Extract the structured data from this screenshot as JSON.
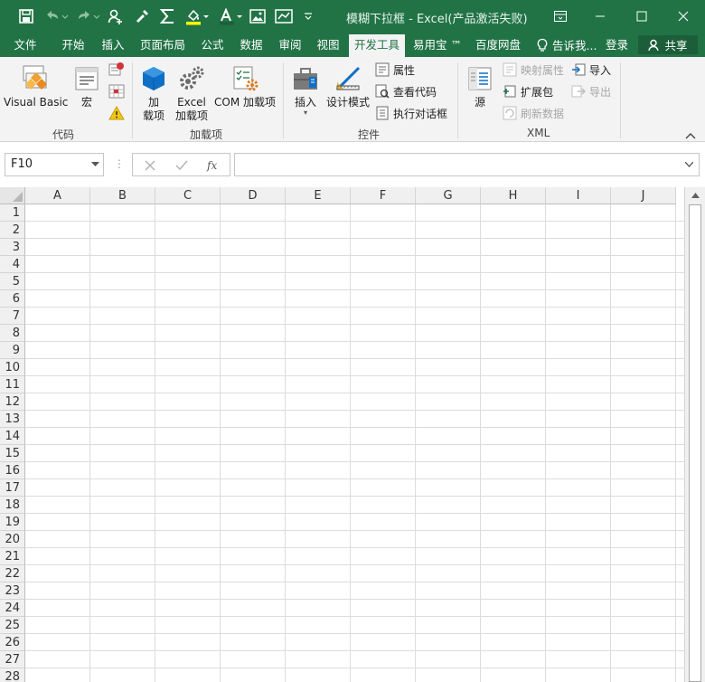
{
  "window": {
    "title": "模糊下拉框 - Excel(产品激活失败)"
  },
  "tabs": [
    {
      "label": "文件"
    },
    {
      "label": "开始"
    },
    {
      "label": "插入"
    },
    {
      "label": "页面布局"
    },
    {
      "label": "公式"
    },
    {
      "label": "数据"
    },
    {
      "label": "审阅"
    },
    {
      "label": "视图"
    },
    {
      "label": "开发工具",
      "active": true
    },
    {
      "label": "易用宝 ™"
    },
    {
      "label": "百度网盘"
    }
  ],
  "tell_me": "告诉我...",
  "login": "登录",
  "share": "共享",
  "ribbon": {
    "groups": {
      "code": "代码",
      "addins": "加载项",
      "controls": "控件",
      "xml": "XML"
    },
    "visual_basic": "Visual Basic",
    "macro": "宏",
    "addins_btn": "加\n载项",
    "addins_line1": "加",
    "addins_line2": "载项",
    "excel_addins_line1": "Excel",
    "excel_addins_line2": "加载项",
    "com_addins": "COM 加载项",
    "insert": "插入",
    "design_mode": "设计模式",
    "properties": "属性",
    "view_code": "查看代码",
    "run_dialog": "执行对话框",
    "source": "源",
    "map_properties": "映射属性",
    "expansion_packs": "扩展包",
    "refresh_data": "刷新数据",
    "import": "导入",
    "export": "导出"
  },
  "formula_bar": {
    "name_box": "F10",
    "formula": ""
  },
  "grid": {
    "columns": [
      "A",
      "B",
      "C",
      "D",
      "E",
      "F",
      "G",
      "H",
      "I",
      "J"
    ],
    "rows": [
      "1",
      "2",
      "3",
      "4",
      "5",
      "6",
      "7",
      "8",
      "9",
      "10",
      "11",
      "12",
      "13",
      "14",
      "15",
      "16",
      "17",
      "18",
      "19",
      "20",
      "21",
      "22",
      "23",
      "24",
      "25",
      "26",
      "27",
      "28"
    ]
  },
  "colors": {
    "brand": "#217346",
    "ribbon_bg": "#f3f3f3"
  },
  "icons": {
    "save": "save-icon",
    "undo": "undo-icon",
    "redo": "redo-icon",
    "autosum": "sigma-icon"
  }
}
